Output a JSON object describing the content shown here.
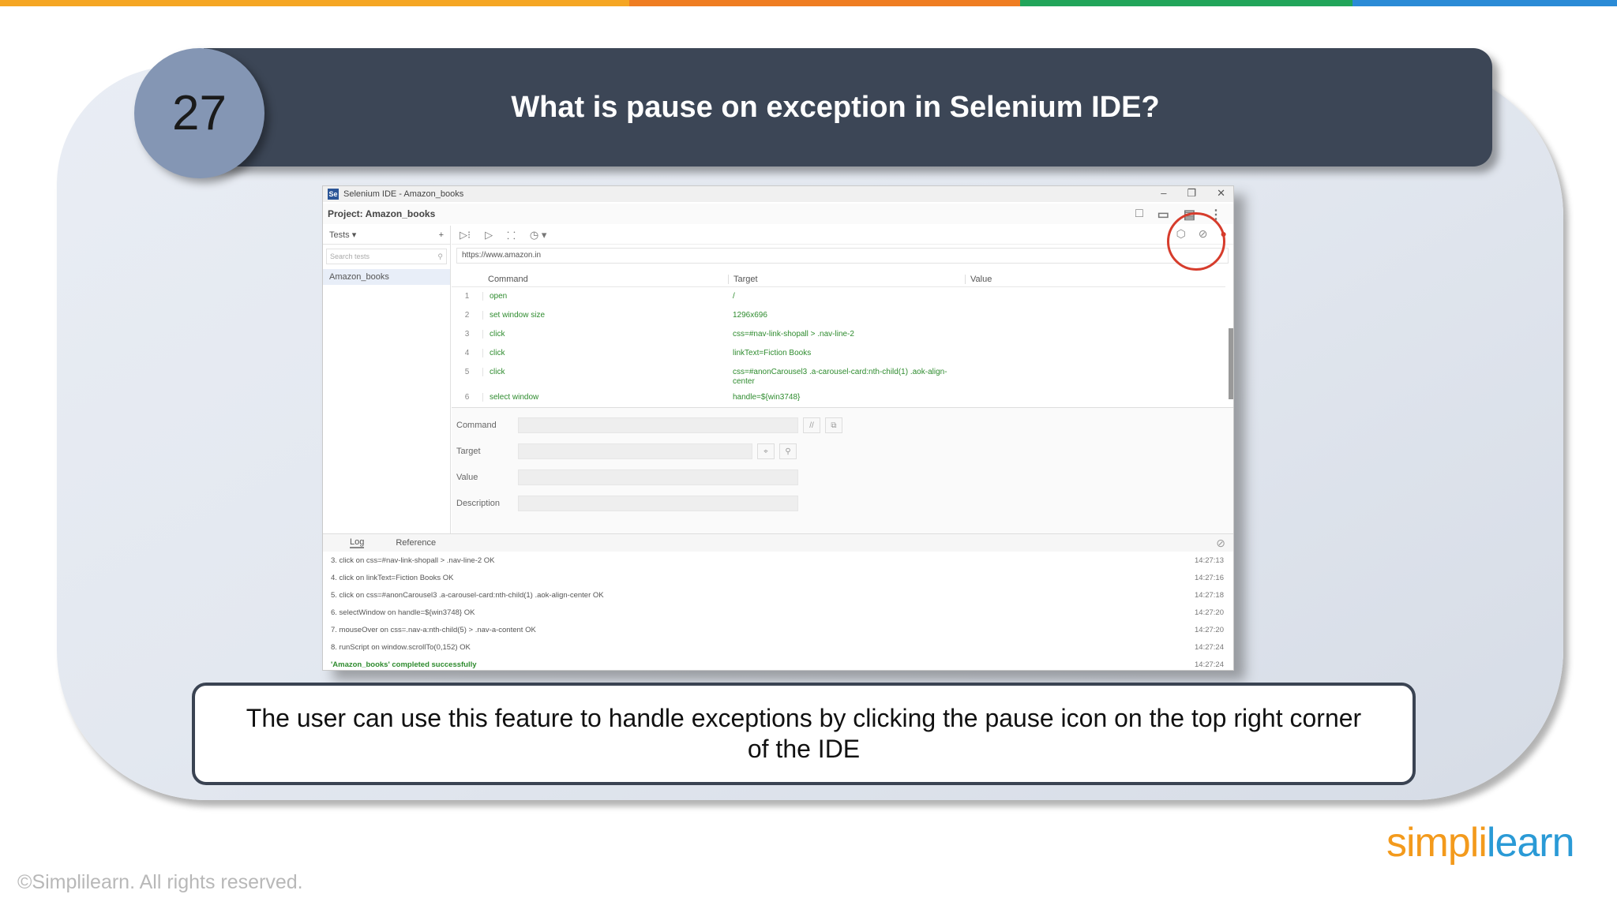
{
  "top_stripe": [
    "#f5a623",
    "#ef7d22",
    "#22a55a",
    "#2b8bd6"
  ],
  "slide": {
    "number": "27",
    "title": "What is pause on exception in Selenium IDE?",
    "caption": "The user can use this feature to handle exceptions by clicking the pause icon on the top right corner of the IDE"
  },
  "ide": {
    "window_title": "Selenium IDE - Amazon_books",
    "project_label": "Project:  Amazon_books",
    "tests_label": "Tests",
    "search_placeholder": "Search tests",
    "test_item": "Amazon_books",
    "url": "https://www.amazon.in",
    "columns": [
      "Command",
      "Target",
      "Value"
    ],
    "commands": [
      {
        "n": "1",
        "cmd": "open",
        "target": "/"
      },
      {
        "n": "2",
        "cmd": "set window size",
        "target": "1296x696"
      },
      {
        "n": "3",
        "cmd": "click",
        "target": "css=#nav-link-shopall > .nav-line-2"
      },
      {
        "n": "4",
        "cmd": "click",
        "target": "linkText=Fiction Books"
      },
      {
        "n": "5",
        "cmd": "click",
        "target": "css=#anonCarousel3 .a-carousel-card:nth-child(1) .aok-align-center"
      },
      {
        "n": "6",
        "cmd": "select window",
        "target": "handle=${win3748}"
      }
    ],
    "editor": {
      "command_label": "Command",
      "target_label": "Target",
      "value_label": "Value",
      "description_label": "Description"
    },
    "log_tabs": [
      "Log",
      "Reference"
    ],
    "log": [
      {
        "text": "3.  click on css=#nav-link-shopall > .nav-line-2 OK",
        "time": "14:27:13"
      },
      {
        "text": "4.  click on linkText=Fiction Books OK",
        "time": "14:27:16"
      },
      {
        "text": "5.  click on css=#anonCarousel3 .a-carousel-card:nth-child(1) .aok-align-center OK",
        "time": "14:27:18"
      },
      {
        "text": "6.  selectWindow on handle=${win3748} OK",
        "time": "14:27:20"
      },
      {
        "text": "7.  mouseOver on css=.nav-a:nth-child(5) > .nav-a-content OK",
        "time": "14:27:20"
      },
      {
        "text": "8.  runScript on window.scrollTo(0,152) OK",
        "time": "14:27:24"
      },
      {
        "text": "'Amazon_books' completed successfully",
        "time": "14:27:24"
      }
    ]
  },
  "footer": {
    "copyright": "©Simplilearn. All rights reserved.",
    "logo_left": "simpl",
    "logo_mid": "i",
    "logo_right": "learn"
  }
}
